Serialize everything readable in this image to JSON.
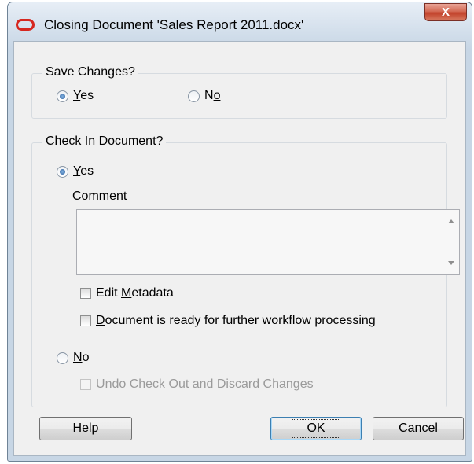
{
  "window": {
    "title": "Closing Document 'Sales Report 2011.docx'",
    "close_glyph": "X"
  },
  "save_changes": {
    "label": "Save Changes?",
    "yes": {
      "pre": "",
      "key": "Y",
      "post": "es",
      "selected": true
    },
    "no": {
      "pre": "N",
      "key": "o",
      "post": "",
      "selected": false
    }
  },
  "check_in": {
    "label": "Check In Document?",
    "yes": {
      "pre": "",
      "key": "Y",
      "post": "es",
      "selected": true
    },
    "comment_label": "Comment",
    "comment_value": "",
    "edit_metadata": {
      "pre": "Edit ",
      "key": "M",
      "post": "etadata",
      "checked": false
    },
    "ready": {
      "pre": "",
      "key": "D",
      "post": "ocument is ready for further workflow processing",
      "checked": false
    },
    "no": {
      "pre": "",
      "key": "N",
      "post": "o",
      "selected": false
    },
    "undo": {
      "pre": "",
      "key": "U",
      "post": "ndo Check Out and Discard Changes",
      "checked": false,
      "disabled": true
    }
  },
  "buttons": {
    "help": {
      "pre": "",
      "key": "H",
      "post": "elp"
    },
    "ok": "OK",
    "cancel": "Cancel"
  },
  "colors": {
    "title_gradient_top": "#e7eef6",
    "title_gradient_bottom": "#c7d6e5",
    "close_red": "#c2412a",
    "client_bg": "#f0f0f0",
    "oracle_red": "#d6271f"
  }
}
